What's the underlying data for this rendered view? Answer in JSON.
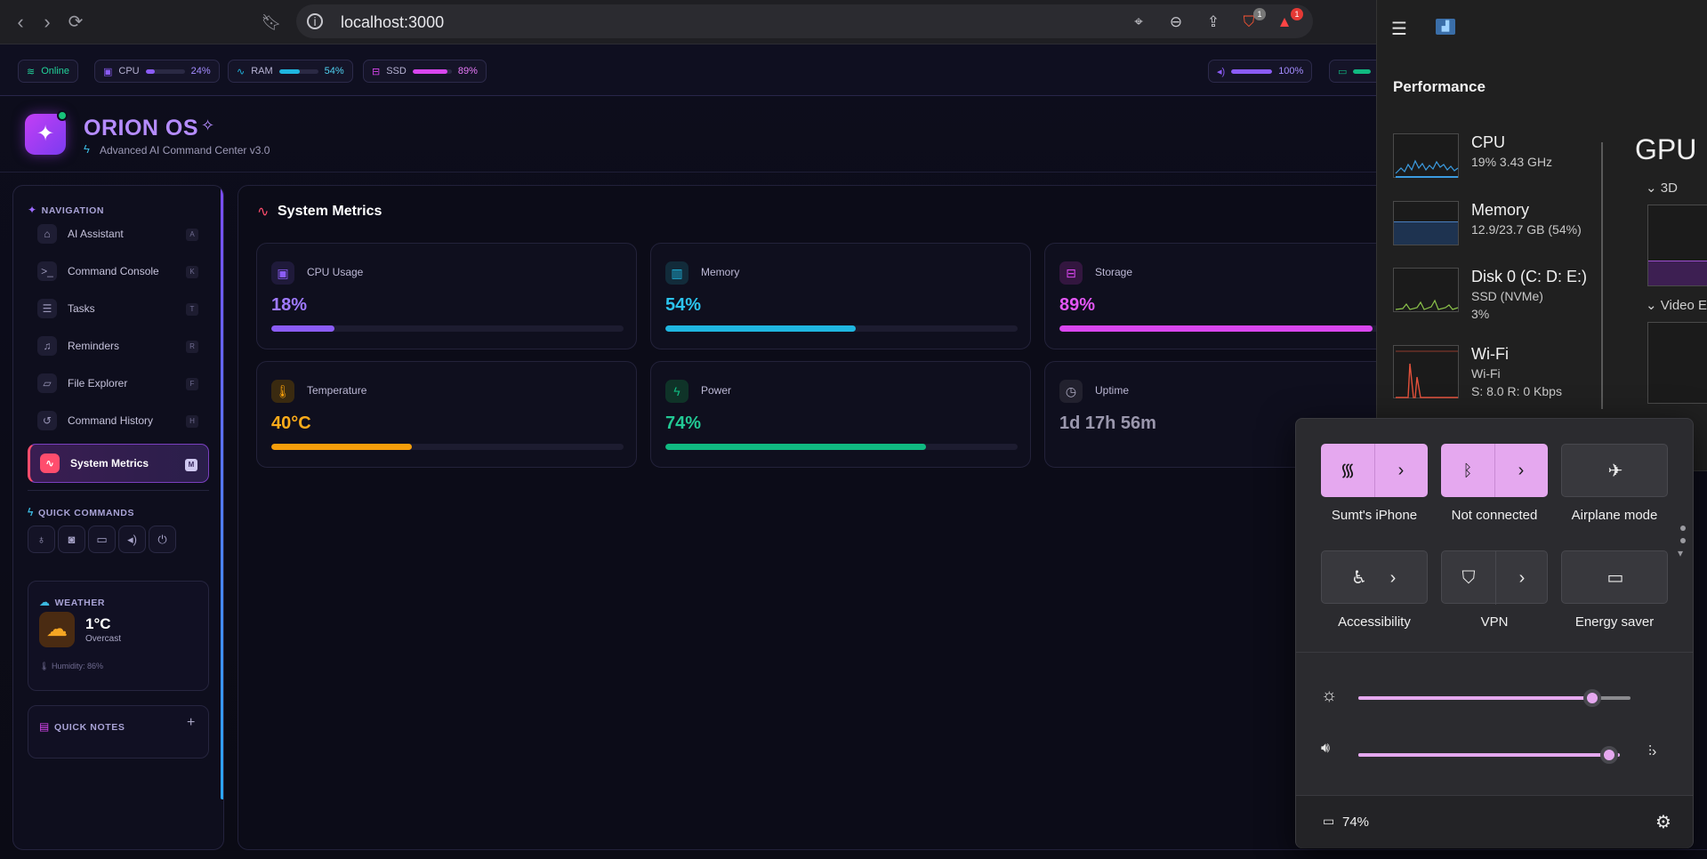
{
  "browser": {
    "url": "localhost:3000",
    "brave_badge": "1",
    "alert_badge": "1"
  },
  "status": {
    "online": "Online",
    "cpu_label": "CPU",
    "cpu_pct": "24%",
    "cpu_value": 24,
    "ram_label": "RAM",
    "ram_pct": "54%",
    "ram_value": 54,
    "ssd_label": "SSD",
    "ssd_pct": "89%",
    "ssd_value": 89,
    "volume_pct": "100%",
    "volume_value": 100
  },
  "header": {
    "title": "ORION OS",
    "subtitle": "Advanced AI Command Center v3.0"
  },
  "sidebar": {
    "nav_label": "NAVIGATION",
    "items": [
      {
        "label": "AI Assistant",
        "key": "A"
      },
      {
        "label": "Command Console",
        "key": "K"
      },
      {
        "label": "Tasks",
        "key": "T"
      },
      {
        "label": "Reminders",
        "key": "R"
      },
      {
        "label": "File Explorer",
        "key": "F"
      },
      {
        "label": "Command History",
        "key": "H"
      },
      {
        "label": "System Metrics",
        "key": "M"
      }
    ],
    "quick_commands_label": "QUICK COMMANDS",
    "weather_label": "WEATHER",
    "weather_temp": "1°C",
    "weather_desc": "Overcast",
    "weather_humidity": "Humidity: 86%",
    "notes_label": "QUICK NOTES",
    "notes_add": "+"
  },
  "main": {
    "title": "System Metrics",
    "metrics": [
      {
        "label": "CPU Usage",
        "value": "18%",
        "level": 18,
        "color": "#8b5cf6"
      },
      {
        "label": "Memory",
        "value": "54%",
        "level": 54,
        "color": "#1fb6e0"
      },
      {
        "label": "Storage",
        "value": "89%",
        "level": 89,
        "color": "#d946ef"
      },
      {
        "label": "Temperature",
        "value": "40°C",
        "level": 40,
        "color": "#f59e0b"
      },
      {
        "label": "Power",
        "value": "74%",
        "level": 74,
        "color": "#10b981"
      },
      {
        "label": "Uptime",
        "value": "1d 17h 56m"
      }
    ]
  },
  "taskmanager": {
    "section": "Performance",
    "items": [
      {
        "name": "CPU",
        "line1": "19%  3.43 GHz"
      },
      {
        "name": "Memory",
        "line1": "12.9/23.7 GB (54%)"
      },
      {
        "name": "Disk 0 (C: D: E:)",
        "line1": "SSD (NVMe)",
        "line2": "3%"
      },
      {
        "name": "Wi-Fi",
        "line1": "Wi-Fi",
        "line2": "S: 8.0  R: 0 Kbps"
      }
    ],
    "gpu_title": "GPU",
    "gpu_3d": "3D",
    "gpu_video": "Video E"
  },
  "quick_settings": {
    "tiles": [
      {
        "label": "Sumt's iPhone"
      },
      {
        "label": "Not connected"
      },
      {
        "label": "Airplane mode"
      },
      {
        "label": "Accessibility"
      },
      {
        "label": "VPN"
      },
      {
        "label": "Energy saver"
      }
    ],
    "brightness_level": 86,
    "volume_level": 96,
    "battery": "74%"
  },
  "colors": {
    "accent_purple": "#8b5cf6",
    "accent_pink": "#ff4d6d",
    "flyout_accent": "#e5a8ef"
  }
}
